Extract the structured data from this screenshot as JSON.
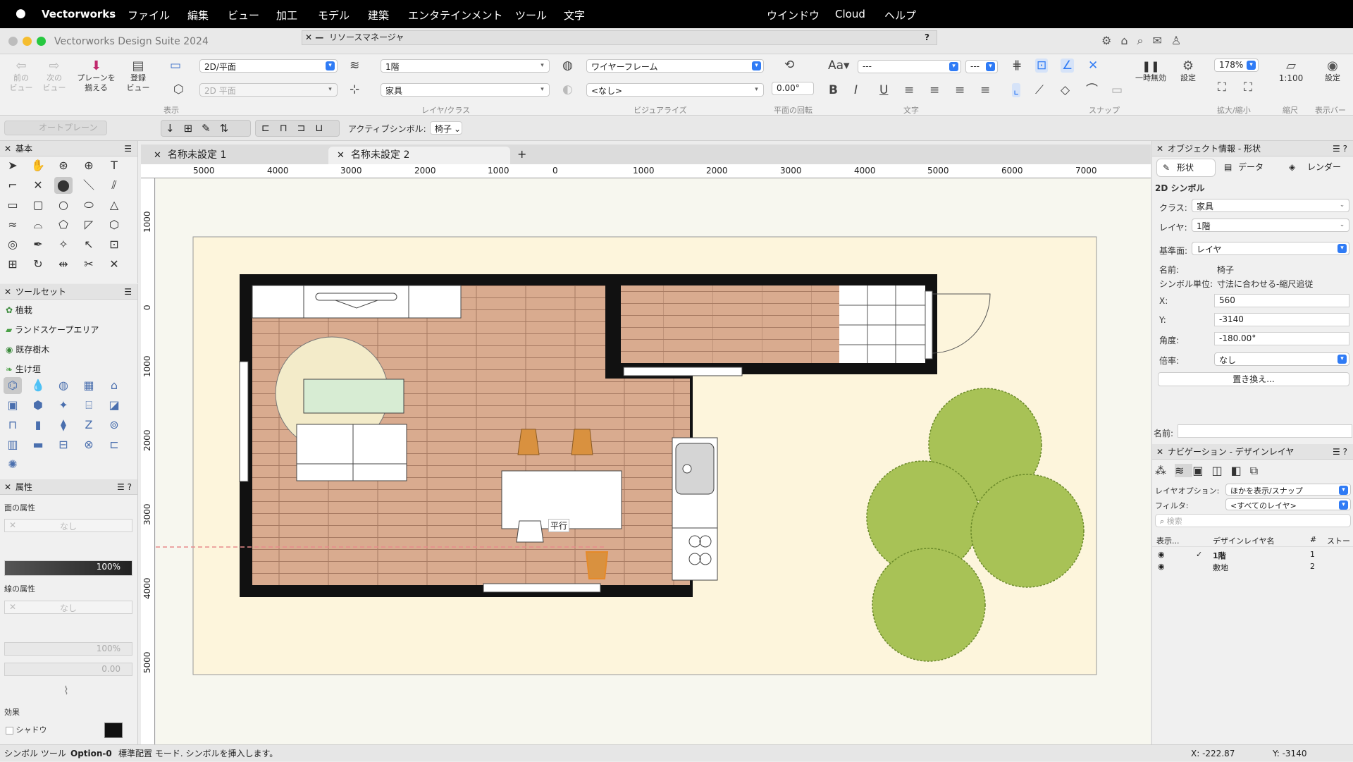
{
  "menubar": {
    "app": "Vectorworks",
    "items": [
      "ファイル",
      "編集",
      "ビュー",
      "加工",
      "モデル",
      "建築",
      "エンタテインメント",
      "ツール",
      "文字"
    ],
    "right": [
      "ウインドウ",
      "Cloud",
      "ヘルプ"
    ]
  },
  "window": {
    "title": "Vectorworks Design Suite 2024",
    "resource_manager": "リソースマネージャ",
    "help": "?"
  },
  "toolbar": {
    "prev_view": "前の\nビュー",
    "next_view": "次の\nビュー",
    "align_plane": "プレーンを\n揃える",
    "register_view": "登録\nビュー",
    "view_mode": "2D/平面",
    "view_mode2": "2D 平面",
    "group_view": "表示",
    "layer": "1階",
    "class": "家具",
    "group_layer": "レイヤ/クラス",
    "render": "ワイヤーフレーム",
    "render2": "<なし>",
    "group_visualize": "ビジュアライズ",
    "rotation": "0.00°",
    "group_rotation": "平面の回転",
    "font_size": "---",
    "font_style": "---",
    "group_text": "文字",
    "group_snap": "スナップ",
    "pause": "一時無効",
    "settings": "設定",
    "zoom": "178%",
    "group_zoom": "拡大/縮小",
    "scale": "1:100",
    "group_scale": "縮尺",
    "view_settings": "設定",
    "group_viewbar": "表示バー"
  },
  "modebar": {
    "auto_plane": "オートプレーン",
    "active_symbol_label": "アクティブシンボル:",
    "active_symbol": "椅子"
  },
  "tools_panel": {
    "title": "基本"
  },
  "toolset_panel": {
    "title": "ツールセット",
    "items": [
      "植栽",
      "ランドスケープエリア",
      "既存樹木",
      "生け垣"
    ]
  },
  "attributes": {
    "title": "属性",
    "fill_label": "面の属性",
    "fill_value": "なし",
    "opacity": "100%",
    "line_label": "線の属性",
    "line_value": "なし",
    "line_opacity": "100%",
    "line_width": "0.00",
    "effects": "効果",
    "shadow": "シャドウ"
  },
  "tabs": [
    {
      "label": "名称未設定 1"
    },
    {
      "label": "名称未設定 2"
    }
  ],
  "rulers": {
    "h": [
      "5000",
      "4000",
      "3000",
      "2000",
      "1000",
      "0",
      "1000",
      "2000",
      "3000",
      "4000",
      "5000",
      "6000",
      "7000"
    ],
    "v": [
      "1000",
      "0",
      "1000",
      "2000",
      "3000",
      "4000",
      "5000"
    ]
  },
  "canvas": {
    "snap_hint": "平行"
  },
  "oip": {
    "title": "オブジェクト情報 - 形状",
    "tabs": [
      "形状",
      "データ",
      "レンダー"
    ],
    "kind": "2D シンボル",
    "class_label": "クラス:",
    "class_value": "家具",
    "layer_label": "レイヤ:",
    "layer_value": "1階",
    "plane_label": "基準面:",
    "plane_value": "レイヤ",
    "name_label": "名前:",
    "name_value": "椅子",
    "unit_label": "シンボル単位:",
    "unit_value": "寸法に合わせる-縮尺追従",
    "x_label": "X:",
    "x_value": "560",
    "y_label": "Y:",
    "y_value": "-3140",
    "angle_label": "角度:",
    "angle_value": "-180.00°",
    "scale_label": "倍率:",
    "scale_value": "なし",
    "replace": "置き換え...",
    "footer_name": "名前:"
  },
  "nav": {
    "title": "ナビゲーション - デザインレイヤ",
    "option_label": "レイヤオプション:",
    "option_value": "ほかを表示/スナップ",
    "filter_label": "フィルタ:",
    "filter_value": "<すべてのレイヤ>",
    "search": "検索",
    "col_show": "表示...",
    "col_name": "デザインレイヤ名",
    "col_num": "#",
    "col_stack": "ストー",
    "rows": [
      {
        "name": "1階",
        "num": "1"
      },
      {
        "name": "敷地",
        "num": "2"
      }
    ]
  },
  "status": {
    "tool": "シンボル ツール",
    "shortcut": "Option-0",
    "mode": "標準配置 モード. シンボルを挿入します。",
    "x": "X: -222.87",
    "y": "Y: -3140"
  }
}
